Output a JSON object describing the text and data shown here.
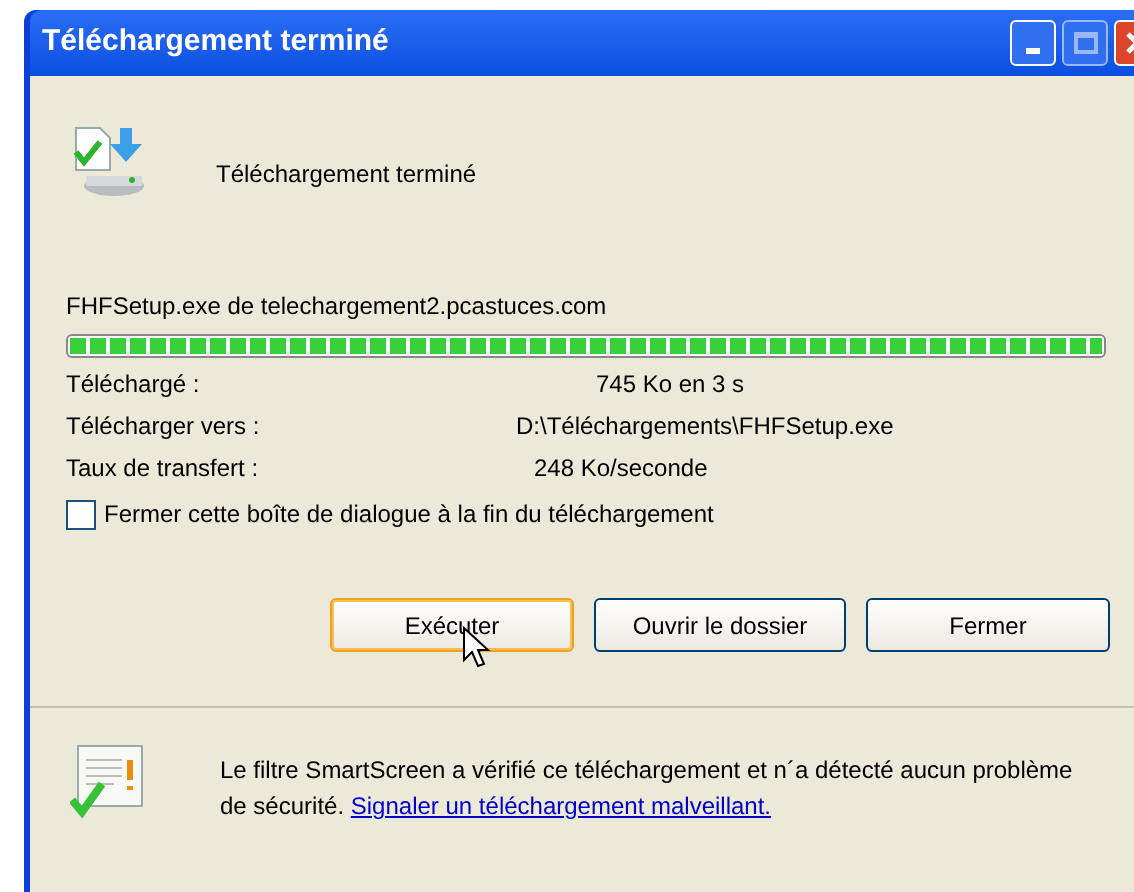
{
  "window": {
    "title": "Téléchargement terminé"
  },
  "header": {
    "message": "Téléchargement terminé"
  },
  "file": {
    "source": "FHFSetup.exe de telechargement2.pcastuces.com"
  },
  "progress": {
    "level": 1
  },
  "details": [
    {
      "label": "Téléchargé :",
      "value": "745 Ko en 3 s"
    },
    {
      "label": "Télécharger vers :",
      "value": "D:\\Téléchargements\\FHFSetup.exe"
    },
    {
      "label": "Taux de transfert :",
      "value": "248 Ko/seconde"
    }
  ],
  "close_on_finish": {
    "label": "Fermer cette boîte de dialogue à la fin du téléchargement",
    "checked": false
  },
  "buttons": [
    {
      "label": "Exécuter",
      "focused": true
    },
    {
      "label": "Ouvrir le dossier",
      "focused": false
    },
    {
      "label": "Fermer",
      "focused": false
    }
  ],
  "smartscreen": {
    "text": "Le filtre SmartScreen a vérifié ce téléchargement et n´a détecté aucun problème de sécurité.",
    "link": "Signaler un téléchargement malveillant."
  }
}
